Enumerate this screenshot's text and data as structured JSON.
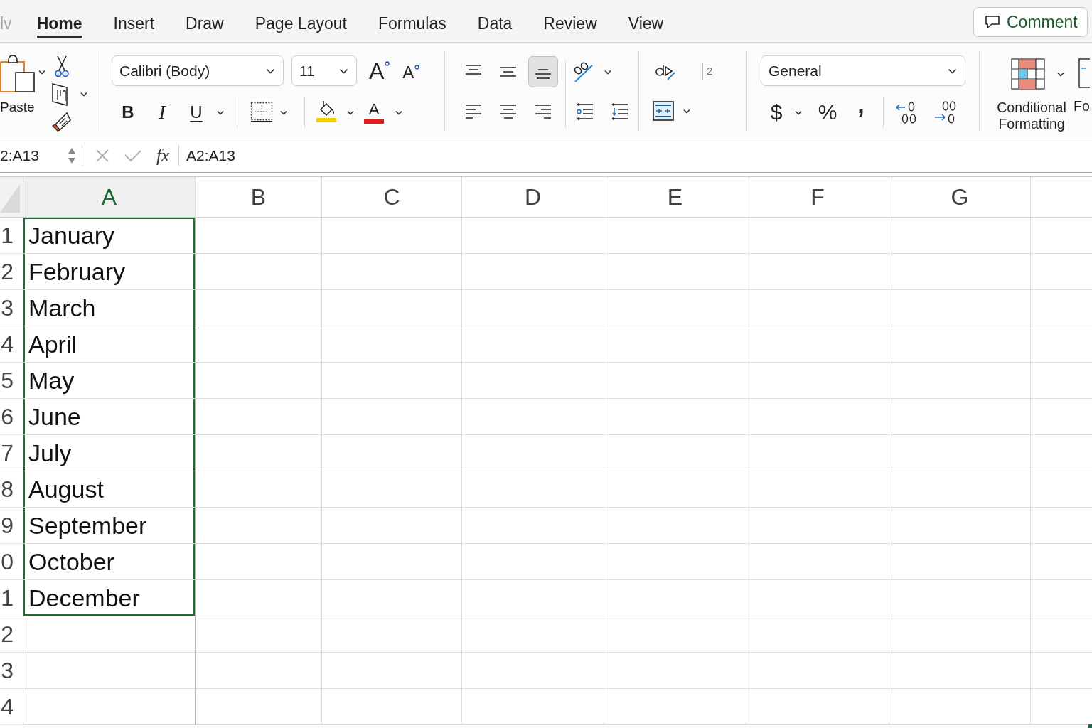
{
  "tabs": [
    {
      "label": "lv",
      "selected": false,
      "dimmed": true
    },
    {
      "label": "Home",
      "selected": true,
      "dimmed": false
    },
    {
      "label": "Insert",
      "selected": false,
      "dimmed": false
    },
    {
      "label": "Draw",
      "selected": false,
      "dimmed": false
    },
    {
      "label": "Page Layout",
      "selected": false,
      "dimmed": false
    },
    {
      "label": "Formulas",
      "selected": false,
      "dimmed": false
    },
    {
      "label": "Data",
      "selected": false,
      "dimmed": false
    },
    {
      "label": "Review",
      "selected": false,
      "dimmed": false
    },
    {
      "label": "View",
      "selected": false,
      "dimmed": false
    }
  ],
  "comment_button": {
    "label": "Comment"
  },
  "clipboard": {
    "paste_label": "Paste"
  },
  "font": {
    "name": "Calibri (Body)",
    "size": "11",
    "grow_label": "A",
    "shrink_label": "A",
    "styles": [
      {
        "kind": "bold",
        "label": "B"
      },
      {
        "kind": "italic",
        "label": "I"
      },
      {
        "kind": "underline",
        "label": "U"
      }
    ],
    "color_label": "A"
  },
  "alignment": {
    "vertical": [
      {
        "kind": "top",
        "selected": false
      },
      {
        "kind": "middle",
        "selected": false
      },
      {
        "kind": "bottom",
        "selected": true
      }
    ],
    "horizontal": [
      {
        "kind": "left",
        "selected": false
      },
      {
        "kind": "center",
        "selected": false
      },
      {
        "kind": "right",
        "selected": false
      }
    ]
  },
  "wrap": {
    "label": "2"
  },
  "number": {
    "format": "General",
    "currency_label": "$",
    "percent_label": "%",
    "comma_label": ","
  },
  "styles": {
    "conditional_formatting_label": "Conditional Formatting",
    "next_label": "Fo"
  },
  "formula_bar": {
    "name_box": "2:A13",
    "function_label": "fx",
    "formula": "A2:A13"
  },
  "sheet": {
    "columns": [
      {
        "label": "A",
        "selected": true
      },
      {
        "label": "B",
        "selected": false
      },
      {
        "label": "C",
        "selected": false
      },
      {
        "label": "D",
        "selected": false
      },
      {
        "label": "E",
        "selected": false
      },
      {
        "label": "F",
        "selected": false
      },
      {
        "label": "G",
        "selected": false
      }
    ],
    "rows": [
      {
        "header": "1",
        "selected": true,
        "cells": [
          "January"
        ]
      },
      {
        "header": "2",
        "selected": true,
        "cells": [
          "February"
        ]
      },
      {
        "header": "3",
        "selected": true,
        "cells": [
          "March"
        ]
      },
      {
        "header": "4",
        "selected": true,
        "cells": [
          "April"
        ]
      },
      {
        "header": "5",
        "selected": true,
        "cells": [
          "May"
        ]
      },
      {
        "header": "6",
        "selected": true,
        "cells": [
          "June"
        ]
      },
      {
        "header": "7",
        "selected": true,
        "cells": [
          "July"
        ]
      },
      {
        "header": "8",
        "selected": true,
        "cells": [
          "August"
        ]
      },
      {
        "header": "9",
        "selected": true,
        "cells": [
          "September"
        ]
      },
      {
        "header": "0",
        "selected": true,
        "cells": [
          "October"
        ]
      },
      {
        "header": "1",
        "selected": true,
        "cells": [
          "December"
        ]
      },
      {
        "header": "2",
        "selected": false
      },
      {
        "header": "3",
        "selected": false
      },
      {
        "header": "4",
        "selected": false
      }
    ]
  }
}
